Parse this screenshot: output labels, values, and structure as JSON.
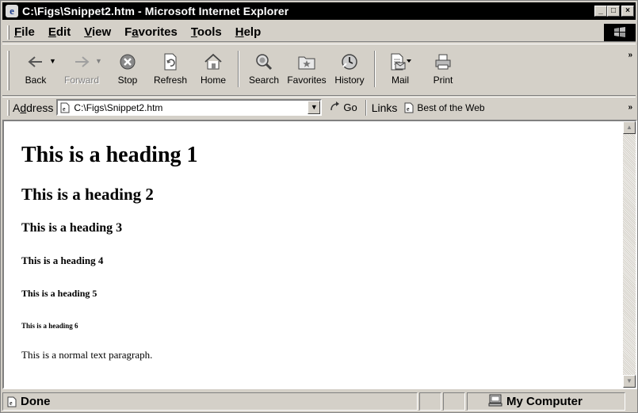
{
  "window": {
    "title": "C:\\Figs\\Snippet2.htm - Microsoft Internet Explorer",
    "controls": [
      "_",
      "□",
      "×"
    ]
  },
  "menu": {
    "items": [
      {
        "underline": "F",
        "rest": "ile"
      },
      {
        "underline": "E",
        "rest": "dit"
      },
      {
        "underline": "V",
        "rest": "iew"
      },
      {
        "pre": "F",
        "underline": "a",
        "rest": "vorites"
      },
      {
        "underline": "T",
        "rest": "ools"
      },
      {
        "underline": "H",
        "rest": "elp"
      }
    ]
  },
  "toolbar": {
    "back": "Back",
    "forward": "Forward",
    "stop": "Stop",
    "refresh": "Refresh",
    "home": "Home",
    "search": "Search",
    "favorites": "Favorites",
    "history": "History",
    "mail": "Mail",
    "print": "Print",
    "more": "»"
  },
  "address": {
    "label_pre": "A",
    "label_u": "d",
    "label_rest": "dress",
    "value": "C:\\Figs\\Snippet2.htm",
    "go": "Go",
    "links_label": "Links",
    "link1": "Best of the Web",
    "more": "»"
  },
  "content": {
    "h1": "This is a heading 1",
    "h2": "This is a heading 2",
    "h3": "This is a heading 3",
    "h4": "This is a heading 4",
    "h5": "This is a heading 5",
    "h6": "This is a heading 6",
    "p": "This is a normal text paragraph."
  },
  "status": {
    "text": "Done",
    "zone": "My Computer"
  }
}
